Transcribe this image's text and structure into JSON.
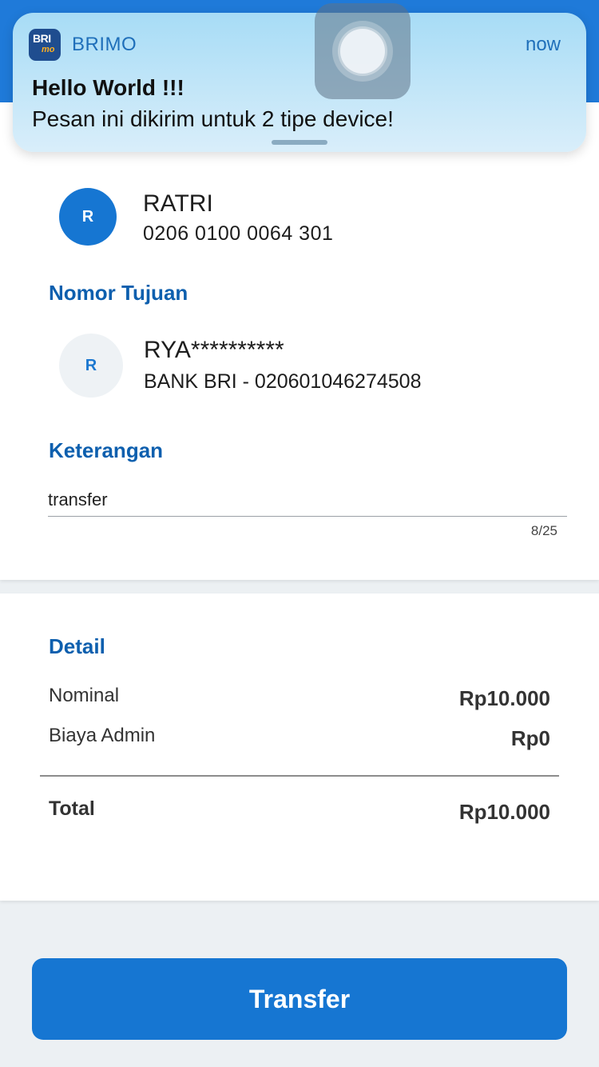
{
  "colors": {
    "brand": "#1676d2",
    "section_label": "#0d5fae",
    "header": "#1f7ad9",
    "background": "#ecf0f3"
  },
  "notification": {
    "app_name": "BRIMO",
    "icon_text_top": "BRI",
    "icon_text_bottom": "mo",
    "time": "now",
    "title": "Hello World !!!",
    "body": "Pesan ini dikirim untuk 2 tipe device!"
  },
  "source": {
    "initial": "R",
    "name": "RATRI",
    "account": "0206 0100 0064 301"
  },
  "destination": {
    "section_label": "Nomor Tujuan",
    "initial": "R",
    "name": "RYA**********",
    "account": "BANK BRI - 020601046274508"
  },
  "keterangan": {
    "section_label": "Keterangan",
    "value": "transfer",
    "counter": "8/25"
  },
  "detail": {
    "section_label": "Detail",
    "rows": [
      {
        "label": "Nominal",
        "value": "Rp10.000"
      },
      {
        "label": "Biaya Admin",
        "value": "Rp0"
      }
    ],
    "total_label": "Total",
    "total_value": "Rp10.000"
  },
  "actions": {
    "transfer_label": "Transfer"
  }
}
